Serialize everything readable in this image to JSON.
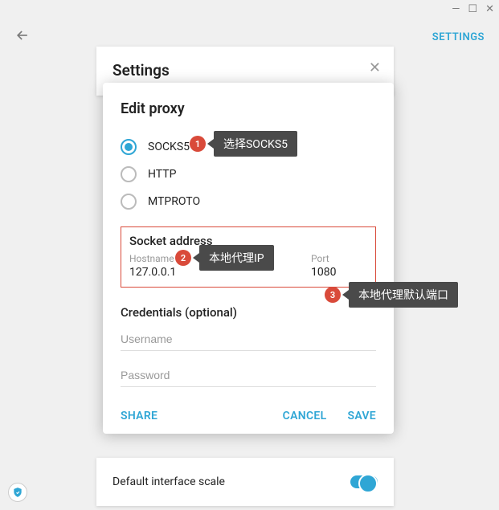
{
  "window": {
    "minimize": "—",
    "maximize": "☐",
    "close": "✕"
  },
  "topbar": {
    "settings_link": "SETTINGS"
  },
  "underlay": {
    "title": "Settings",
    "bottom_row_label": "Default interface scale"
  },
  "modal": {
    "title": "Edit proxy",
    "proxy_types": {
      "socks5": "SOCKS5",
      "http": "HTTP",
      "mtproto": "MTPROTO"
    },
    "socket_section_title": "Socket address",
    "hostname_label": "Hostname",
    "hostname_value": "127.0.0.1",
    "port_label": "Port",
    "port_value": "1080",
    "credentials_title": "Credentials (optional)",
    "username_placeholder": "Username",
    "password_placeholder": "Password",
    "share": "SHARE",
    "cancel": "CANCEL",
    "save": "SAVE"
  },
  "callouts": {
    "c1_num": "1",
    "c1_text": "选择SOCKS5",
    "c2_num": "2",
    "c2_text": "本地代理IP",
    "c3_num": "3",
    "c3_text": "本地代理默认端口"
  }
}
